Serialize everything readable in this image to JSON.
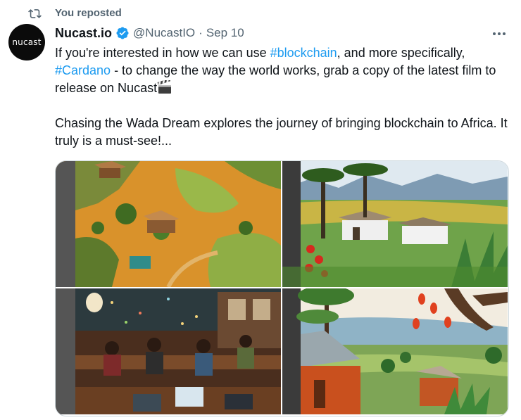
{
  "repost": {
    "icon": "repost-icon",
    "label": "You reposted"
  },
  "author": {
    "avatar_text": "nucast",
    "display_name": "Nucast.io",
    "verified": true,
    "handle": "@NucastIO",
    "separator": "·",
    "date": "Sep 10"
  },
  "tweet": {
    "p1_before": "If you're interested in how we can use ",
    "hashtag1": "#blockchain",
    "p1_middle": ", and more specifically, ",
    "hashtag2": "#Cardano",
    "p1_after": " - to change the way the world works, grab a copy of the latest film to release on Nucast",
    "p1_emoji": "clapper-board-icon",
    "p2": "Chasing the Wada Dream explores the journey of bringing blockchain to Africa. It truly is a must-see!..."
  },
  "media": {
    "images": [
      {
        "name": "aerial-village-painting",
        "description": "Aerial view of an African village painting"
      },
      {
        "name": "huts-landscape-painting",
        "description": "Painting of huts in a green valley with mountains"
      },
      {
        "name": "classroom-laptops-photo",
        "description": "People working on laptops in a study hall"
      },
      {
        "name": "red-house-landscape-painting",
        "description": "Painting of red houses with hills and trees"
      }
    ]
  },
  "colors": {
    "link": "#1d9bf0",
    "secondary_text": "#536471",
    "verified_badge": "#1d9bf0",
    "primary_text": "#0f1419"
  }
}
